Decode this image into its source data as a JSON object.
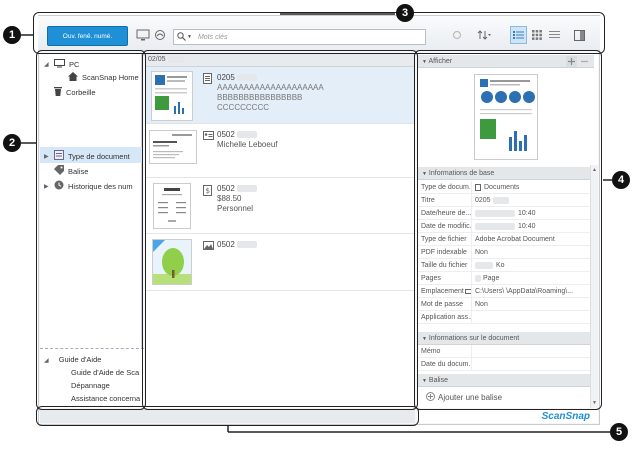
{
  "toolbar": {
    "open_button": "Ouv. fenê. numé.",
    "search_placeholder": "Mots clés"
  },
  "left_pane": {
    "tree": [
      {
        "label": "PC"
      },
      {
        "label": "ScanSnap Home"
      },
      {
        "label": "Corbeille"
      }
    ],
    "filters": [
      {
        "label": "Type de document"
      },
      {
        "label": "Balise"
      },
      {
        "label": "Historique des num"
      }
    ],
    "help": {
      "title": "Guide d'Aide",
      "items": [
        "Guide d'Aide de Sca",
        "Dépannage",
        "Assistance concerna"
      ]
    }
  },
  "list": {
    "date_header": "02/05",
    "items": [
      {
        "line1": "0205",
        "line2": "AAAAAAAAAAAAAAAAAAAA",
        "line3": "BBBBBBBBBBBBBBBB",
        "line4": "CCCCCCCCC"
      },
      {
        "line1": "0502",
        "line2": "Michelle Leboeuf"
      },
      {
        "line1": "0502",
        "line2": "$88.50",
        "line3": "Personnel"
      },
      {
        "line1": "0502"
      }
    ]
  },
  "right_pane": {
    "afficher": "Afficher",
    "basic_info_header": "Informations de base",
    "properties": [
      {
        "key": "Type de docum...",
        "value": "Documents"
      },
      {
        "key": "Titre",
        "value": "0205"
      },
      {
        "key": "Date/heure de...",
        "value": "10:40"
      },
      {
        "key": "Date de modific...",
        "value": "10:40"
      },
      {
        "key": "Type de fichier",
        "value": "Adobe Acrobat Document"
      },
      {
        "key": "PDF indexable",
        "value": "Non"
      },
      {
        "key": "Taille du fichier",
        "value": "Ko"
      },
      {
        "key": "Pages",
        "value": "Page"
      },
      {
        "key": "Emplacement",
        "value": "C:\\Users\\ \\AppData\\Roaming\\..."
      },
      {
        "key": "Mot de passe",
        "value": "Non"
      },
      {
        "key": "Application ass...",
        "value": ""
      }
    ],
    "doc_info_header": "Informations sur le document",
    "doc_props": [
      {
        "key": "Mémo",
        "value": ""
      },
      {
        "key": "Date du docum...",
        "value": ""
      }
    ],
    "tag_header": "Balise",
    "add_tag": "Ajouter une balise"
  },
  "brand": "ScanSnap",
  "callouts": [
    "1",
    "2",
    "3",
    "4",
    "5"
  ],
  "colors": {
    "accent": "#1f8fd6",
    "selection": "#d6e7f7"
  }
}
